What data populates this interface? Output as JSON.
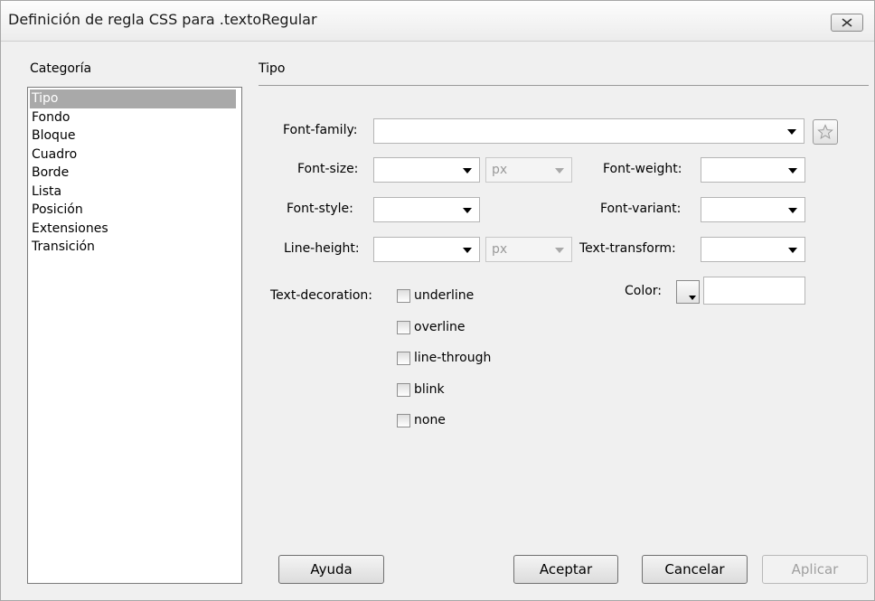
{
  "window": {
    "title": "Definición de regla CSS para .textoRegular"
  },
  "categories": {
    "label": "Categoría",
    "items": [
      "Tipo",
      "Fondo",
      "Bloque",
      "Cuadro",
      "Borde",
      "Lista",
      "Posición",
      "Extensiones",
      "Transición"
    ],
    "selected": "Tipo"
  },
  "section": {
    "title": "Tipo"
  },
  "fields": {
    "font_family": {
      "label": "Font-family:",
      "value": ""
    },
    "font_size": {
      "label": "Font-size:",
      "value": "",
      "unit": "px"
    },
    "font_weight": {
      "label": "Font-weight:",
      "value": ""
    },
    "font_style": {
      "label": "Font-style:",
      "value": ""
    },
    "font_variant": {
      "label": "Font-variant:",
      "value": ""
    },
    "line_height": {
      "label": "Line-height:",
      "value": "",
      "unit": "px"
    },
    "text_transform": {
      "label": "Text-transform:",
      "value": ""
    },
    "text_decoration": {
      "label": "Text-decoration:",
      "options": [
        "underline",
        "overline",
        "line-through",
        "blink",
        "none"
      ]
    },
    "color": {
      "label": "Color:",
      "value": ""
    }
  },
  "buttons": {
    "help": "Ayuda",
    "ok": "Aceptar",
    "cancel": "Cancelar",
    "apply": "Aplicar"
  }
}
